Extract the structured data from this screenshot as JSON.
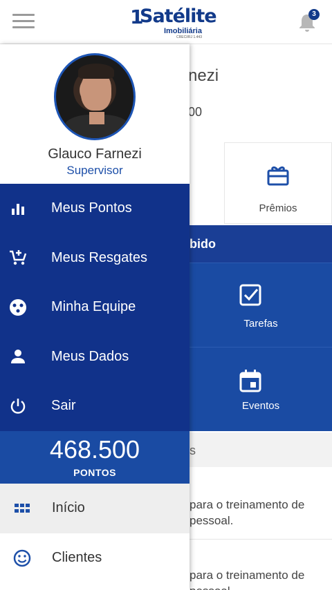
{
  "header": {
    "logo_main": "Satélite",
    "logo_one": "1",
    "logo_sub": "Imobiliária",
    "logo_tiny": "CRECI/RJ 1.443",
    "notifications_count": "3"
  },
  "background": {
    "name_partial": "nezi",
    "points_partial": "00",
    "premios_label": "Prêmios",
    "band_partial": "bido",
    "tarefas_label": "Tarefas",
    "eventos_label": "Eventos",
    "strip_partial": "s",
    "line1": "para o treinamento de",
    "line2": "pessoal.",
    "line3": "para o treinamento de",
    "line4": "pessoal"
  },
  "drawer": {
    "profile": {
      "name": "Glauco Farnezi",
      "role": "Supervisor"
    },
    "menu": [
      {
        "label": "Meus Pontos",
        "icon": "bar-chart-icon"
      },
      {
        "label": "Meus Resgates",
        "icon": "cart-add-icon"
      },
      {
        "label": "Minha Equipe",
        "icon": "team-icon"
      },
      {
        "label": "Meus Dados",
        "icon": "person-icon"
      },
      {
        "label": "Sair",
        "icon": "power-icon"
      }
    ],
    "points": {
      "value": "468.500",
      "label": "PONTOS"
    },
    "nav": [
      {
        "label": "Início",
        "icon": "grid-icon"
      },
      {
        "label": "Clientes",
        "icon": "smiley-icon"
      }
    ]
  },
  "colors": {
    "menu_bg": "#11328a",
    "points_bg": "#1a4ba3",
    "accent": "#1d4fa8"
  }
}
